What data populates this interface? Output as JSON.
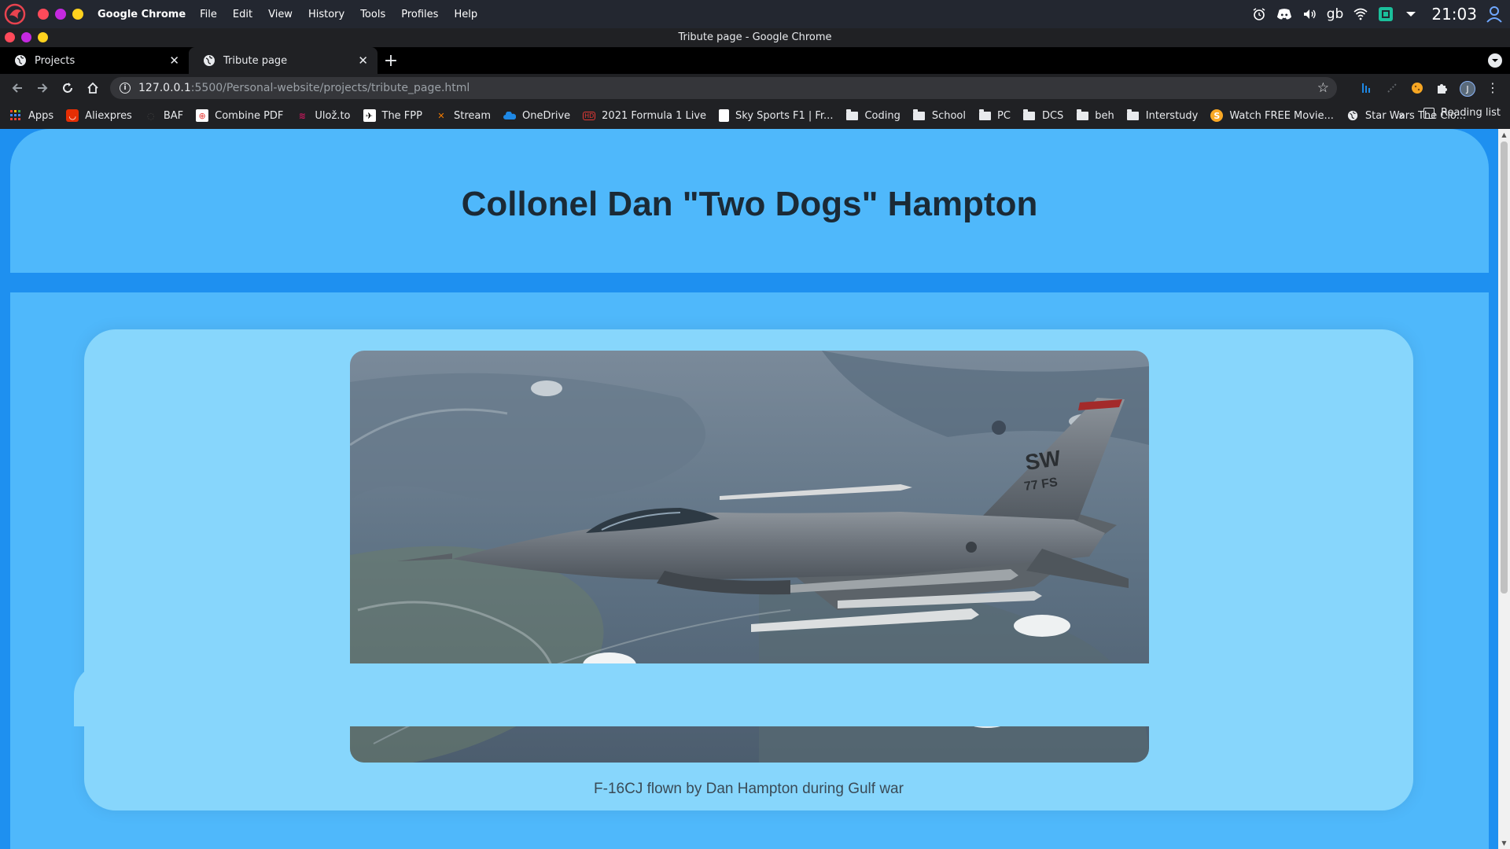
{
  "os": {
    "app_name": "Google Chrome",
    "menu": [
      "File",
      "Edit",
      "View",
      "History",
      "Tools",
      "Profiles",
      "Help"
    ],
    "keyboard_layout": "gb",
    "clock": "21:03"
  },
  "window": {
    "title": "Tribute page - Google Chrome"
  },
  "tabs": [
    {
      "label": "Projects",
      "active": false
    },
    {
      "label": "Tribute page",
      "active": true
    }
  ],
  "address": {
    "host": "127.0.0.1",
    "path": ":5500/Personal-website/projects/tribute_page.html"
  },
  "bookmarks": [
    {
      "label": "Apps",
      "icon": "apps-grid-icon"
    },
    {
      "label": "Aliexpres",
      "icon": "aliexpress-icon"
    },
    {
      "label": "BAF",
      "icon": "baf-icon"
    },
    {
      "label": "Combine PDF",
      "icon": "pdf-icon"
    },
    {
      "label": "Ulož.to",
      "icon": "ulozto-icon"
    },
    {
      "label": "The FPP",
      "icon": "fpp-icon"
    },
    {
      "label": "Stream",
      "icon": "stream-icon"
    },
    {
      "label": "OneDrive",
      "icon": "onedrive-icon"
    },
    {
      "label": "2021 Formula 1 Live",
      "icon": "hd-icon"
    },
    {
      "label": "Sky Sports F1 | Fr...",
      "icon": "page-icon"
    },
    {
      "label": "Coding",
      "icon": "folder-icon"
    },
    {
      "label": "School",
      "icon": "folder-icon"
    },
    {
      "label": "PC",
      "icon": "folder-icon"
    },
    {
      "label": "DCS",
      "icon": "folder-icon"
    },
    {
      "label": "beh",
      "icon": "folder-icon"
    },
    {
      "label": "Interstudy",
      "icon": "folder-icon"
    },
    {
      "label": "Watch FREE Movie...",
      "icon": "movie-icon"
    },
    {
      "label": "Star Wars The Clo...",
      "icon": "globe-icon"
    }
  ],
  "reading_list": "Reading list",
  "page": {
    "title": "Collonel Dan \"Two Dogs\" Hampton",
    "image_caption": "F-16CJ flown by Dan Hampton during Gulf war",
    "tail_code": "SW",
    "tail_number": "77 FS"
  },
  "colors": {
    "page_bg": "#1e90f0",
    "card_bg": "#4fb8fb",
    "inner_card_bg": "#87d6fc",
    "title_color": "#1b2a36"
  }
}
